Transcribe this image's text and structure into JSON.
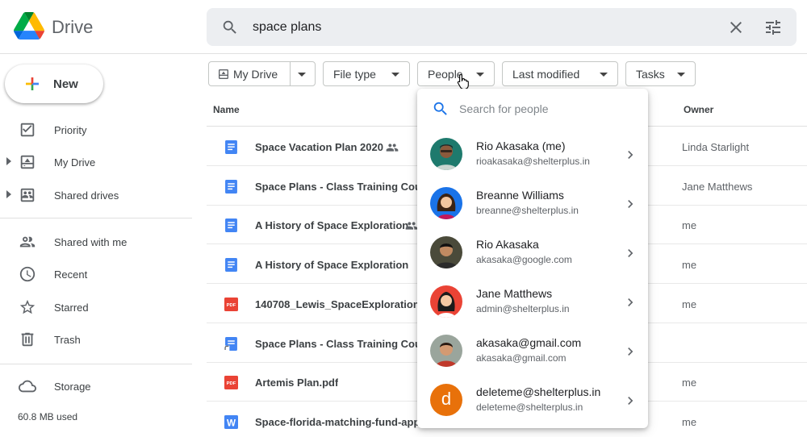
{
  "app": {
    "name": "Drive"
  },
  "search": {
    "query": "space plans"
  },
  "new_button": {
    "label": "New"
  },
  "sidebar": {
    "items": [
      {
        "label": "Priority"
      },
      {
        "label": "My Drive"
      },
      {
        "label": "Shared drives"
      },
      {
        "label": "Shared with me"
      },
      {
        "label": "Recent"
      },
      {
        "label": "Starred"
      },
      {
        "label": "Trash"
      },
      {
        "label": "Storage"
      }
    ],
    "storage_used": "60.8 MB used"
  },
  "filters": {
    "my_drive": "My Drive",
    "file_type": "File type",
    "people": "People",
    "last_modified": "Last modified",
    "tasks": "Tasks"
  },
  "list": {
    "headers": {
      "name": "Name",
      "owner": "Owner"
    },
    "rows": [
      {
        "name": "Space Vacation Plan 2020",
        "owner": "Linda Starlight",
        "icon": "doc-icon",
        "shared": true
      },
      {
        "name": "Space Plans - Class Training Course",
        "owner": "Jane Matthews",
        "icon": "doc-icon",
        "shared": false
      },
      {
        "name": "A History of Space Exploration",
        "owner": "me",
        "icon": "doc-icon",
        "shared": true
      },
      {
        "name": "A History of Space Exploration",
        "owner": "me",
        "icon": "doc-icon",
        "shared": false
      },
      {
        "name": "140708_Lewis_SpaceExploration_",
        "owner": "me",
        "icon": "pdf-icon",
        "shared": false
      },
      {
        "name": "Space Plans - Class Training Course",
        "owner": "",
        "icon": "doc-shortcut-icon",
        "shared": false
      },
      {
        "name": "Artemis Plan.pdf",
        "owner": "me",
        "icon": "pdf-icon",
        "shared": false
      },
      {
        "name": "Space-florida-matching-fund-application",
        "owner": "me",
        "icon": "word-icon",
        "shared": false
      }
    ]
  },
  "people_menu": {
    "search_placeholder": "Search for people",
    "people": [
      {
        "name": "Rio Akasaka (me)",
        "email": "rioakasaka@shelterplus.in"
      },
      {
        "name": "Breanne Williams",
        "email": "breanne@shelterplus.in"
      },
      {
        "name": "Rio Akasaka",
        "email": "akasaka@google.com"
      },
      {
        "name": "Jane Matthews",
        "email": "admin@shelterplus.in"
      },
      {
        "name": "akasaka@gmail.com",
        "email": "akasaka@gmail.com"
      },
      {
        "name": "deleteme@shelterplus.in",
        "email": "deleteme@shelterplus.in",
        "initial": "d"
      }
    ]
  },
  "colors": {
    "accent": "#1a73e8",
    "doc": "#4285f4",
    "pdf": "#ea4335",
    "avatar_initial": "#e8710a"
  }
}
